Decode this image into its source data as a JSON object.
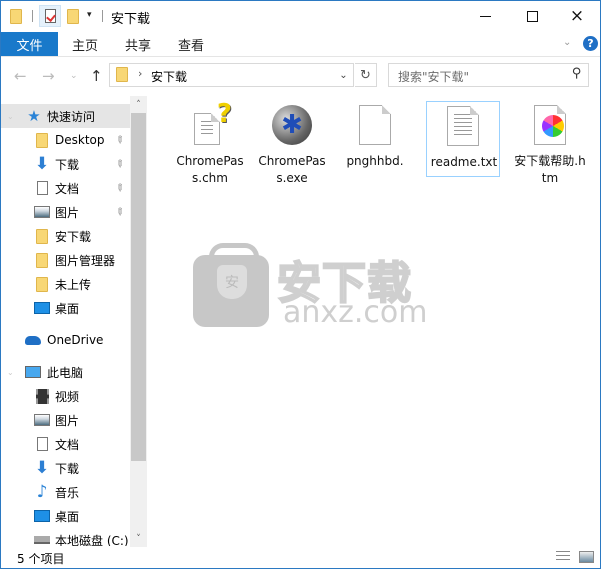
{
  "window": {
    "title": "安下载",
    "controls": {
      "minimize": "minimize",
      "maximize": "maximize",
      "close": "×"
    }
  },
  "quick_access_toolbar": {
    "items": [
      "folder-icon",
      "properties-icon",
      "new-folder-icon",
      "customize-dropdown"
    ],
    "dropdown_glyph": "▾"
  },
  "ribbon": {
    "tabs": [
      {
        "label": "文件",
        "active": true
      },
      {
        "label": "主页"
      },
      {
        "label": "共享"
      },
      {
        "label": "查看"
      }
    ],
    "expand_glyph": "⌄",
    "help_glyph": "?"
  },
  "navigation": {
    "back": "←",
    "forward": "→",
    "recent": "⌄",
    "up": "↑",
    "address": {
      "separator": "›",
      "path": "安下载",
      "dropdown": "⌄",
      "refresh": "↻"
    },
    "search": {
      "placeholder": "搜索\"安下载\"",
      "icon": "⚲"
    }
  },
  "nav_pane": {
    "items": [
      {
        "label": "快速访问",
        "icon": "star-icon",
        "selected": true,
        "level": 0
      },
      {
        "label": "Desktop",
        "icon": "folder-icon",
        "pinned": true,
        "level": 1
      },
      {
        "label": "下载",
        "icon": "download-icon",
        "pinned": true,
        "level": 1
      },
      {
        "label": "文档",
        "icon": "document-icon",
        "pinned": true,
        "level": 1
      },
      {
        "label": "图片",
        "icon": "picture-icon",
        "pinned": true,
        "level": 1
      },
      {
        "label": "安下载",
        "icon": "folder-icon",
        "level": 1
      },
      {
        "label": "图片管理器",
        "icon": "folder-icon",
        "level": 1
      },
      {
        "label": "未上传",
        "icon": "folder-icon",
        "level": 1
      },
      {
        "label": "桌面",
        "icon": "desktop-icon",
        "level": 1
      },
      {
        "label": "OneDrive",
        "icon": "cloud-icon",
        "level": 0
      },
      {
        "label": "此电脑",
        "icon": "computer-icon",
        "level": 0
      },
      {
        "label": "视频",
        "icon": "video-icon",
        "level": 1
      },
      {
        "label": "图片",
        "icon": "picture-icon",
        "level": 1
      },
      {
        "label": "文档",
        "icon": "document-icon",
        "level": 1
      },
      {
        "label": "下载",
        "icon": "download-icon",
        "level": 1
      },
      {
        "label": "音乐",
        "icon": "music-icon",
        "level": 1
      },
      {
        "label": "桌面",
        "icon": "desktop-icon",
        "level": 1
      },
      {
        "label": "本地磁盘 (C:)",
        "icon": "drive-icon",
        "level": 1
      }
    ],
    "scroll_up": "˄",
    "scroll_down": "˅"
  },
  "files": [
    {
      "name": "ChromePass.chm",
      "icon": "chm-help-icon"
    },
    {
      "name": "ChromePass.exe",
      "icon": "exe-app-icon"
    },
    {
      "name": "pnghhbd.",
      "icon": "blank-file-icon"
    },
    {
      "name": "readme.txt",
      "icon": "text-file-icon",
      "selected": true
    },
    {
      "name": "安下载帮助.htm",
      "icon": "htm-file-icon"
    }
  ],
  "watermark": {
    "cn": "安下载",
    "en": "anxz.com",
    "badge": "安"
  },
  "statusbar": {
    "item_count": "5 个项目"
  },
  "colors": {
    "accent": "#1979ca",
    "border": "#2b79c2",
    "selection": "#e5e5e5",
    "selected_file_border": "#99d1ff"
  }
}
